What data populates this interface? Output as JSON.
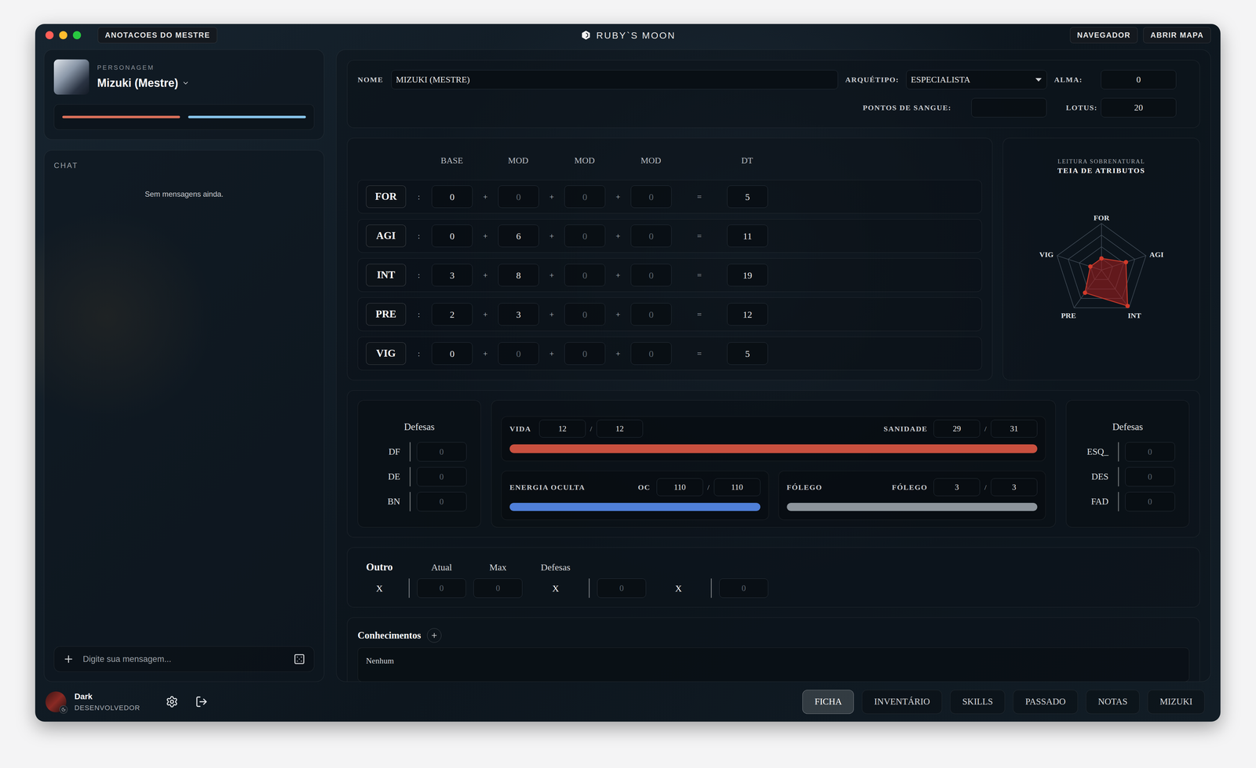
{
  "window": {
    "title": "RUBY`S MOON",
    "traffic_lights": [
      {
        "color": "#ff5f57"
      },
      {
        "color": "#febc2e"
      },
      {
        "color": "#28c840"
      }
    ],
    "left_button": "ANOTACOES DO MESTRE",
    "right_buttons": [
      "NAVEGADOR",
      "ABRIR MAPA"
    ]
  },
  "sidebar": {
    "character": {
      "label": "PERSONAGEM",
      "name": "Mizuki (Mestre)",
      "bars": [
        {
          "level": 1,
          "color": "#d9705a"
        },
        {
          "level": 1,
          "color": "#86c4ea"
        }
      ]
    },
    "chat": {
      "title": "CHAT",
      "empty_message": "Sem mensagens ainda.",
      "placeholder": "Digite sua mensagem..."
    },
    "user": {
      "name": "Dark",
      "role": "DESENVOLVEDOR"
    }
  },
  "identity": {
    "name": {
      "label": "NOME",
      "value": "MIZUKI (MESTRE)"
    },
    "archetype": {
      "label": "ARQUÉTIPO:",
      "value": "ESPECIALISTA"
    },
    "alma": {
      "label": "ALMA:",
      "value": "0"
    },
    "blood": {
      "label": "PONTOS DE SANGUE:",
      "value": ""
    },
    "lotus": {
      "label": "LOTUS:",
      "value": "20"
    }
  },
  "attributes": {
    "columns": [
      "BASE",
      "MOD",
      "MOD",
      "MOD",
      "DT"
    ],
    "colon": ":",
    "plus": "+",
    "equals": "=",
    "rows": [
      {
        "label": "FOR",
        "base": "0",
        "mods": [
          {
            "value": "0",
            "empty": true
          },
          {
            "value": "0",
            "empty": true
          },
          {
            "value": "0",
            "empty": true
          }
        ],
        "dt": "5"
      },
      {
        "label": "AGI",
        "base": "0",
        "mods": [
          {
            "value": "6",
            "empty": false
          },
          {
            "value": "0",
            "empty": true
          },
          {
            "value": "0",
            "empty": true
          }
        ],
        "dt": "11"
      },
      {
        "label": "INT",
        "base": "3",
        "mods": [
          {
            "value": "8",
            "empty": false
          },
          {
            "value": "0",
            "empty": true
          },
          {
            "value": "0",
            "empty": true
          }
        ],
        "dt": "19"
      },
      {
        "label": "PRE",
        "base": "2",
        "mods": [
          {
            "value": "3",
            "empty": false
          },
          {
            "value": "0",
            "empty": true
          },
          {
            "value": "0",
            "empty": true
          }
        ],
        "dt": "12"
      },
      {
        "label": "VIG",
        "base": "0",
        "mods": [
          {
            "value": "0",
            "empty": true
          },
          {
            "value": "0",
            "empty": true
          },
          {
            "value": "0",
            "empty": true
          }
        ],
        "dt": "5"
      }
    ]
  },
  "radar": {
    "subtitle": "LEITURA SOBRENATURAL",
    "title": "TEIA DE ATRIBUTOS",
    "axes": [
      "FOR",
      "AGI",
      "INT",
      "PRE",
      "VIG"
    ],
    "values": [
      5,
      11,
      19,
      12,
      5
    ]
  },
  "defenses_left": {
    "title": "Defesas",
    "rows": [
      {
        "label": "DF",
        "value": "0",
        "empty": true
      },
      {
        "label": "DE",
        "value": "0",
        "empty": true
      },
      {
        "label": "BN",
        "value": "0",
        "empty": true
      }
    ]
  },
  "defenses_right": {
    "title": "Defesas",
    "rows": [
      {
        "label": "ESQ_",
        "value": "0",
        "empty": true
      },
      {
        "label": "DES",
        "value": "0",
        "empty": true
      },
      {
        "label": "FAD",
        "value": "0",
        "empty": true
      }
    ]
  },
  "vitals": {
    "vida": {
      "label": "VIDA",
      "current": "12",
      "max": "12",
      "separator": "/",
      "level": 1,
      "color": "#c9503f"
    },
    "sanidade": {
      "label": "SANIDADE",
      "current": "29",
      "max": "31",
      "separator": "/"
    },
    "energy": {
      "label": "ENERGIA OCULTA",
      "short": "OC",
      "current": "110",
      "max": "110",
      "separator": "/",
      "level": 1,
      "color": "#4f7fd8"
    },
    "folego": {
      "label": "FÓLEGO",
      "short": "FÓLEGO",
      "current": "3",
      "max": "3",
      "separator": "/",
      "level": 1,
      "color": "#8d959c"
    }
  },
  "other": {
    "headers": [
      "Outro",
      "Atual",
      "Max",
      "Defesas"
    ],
    "label": "X",
    "current": {
      "value": "0",
      "empty": true
    },
    "max": {
      "value": "0",
      "empty": true
    },
    "defenses": [
      {
        "label": "X",
        "value": "0",
        "empty": true
      },
      {
        "label": "X",
        "value": "0",
        "empty": true
      }
    ]
  },
  "knowledge": {
    "title": "Conhecimentos",
    "empty_text": "Nenhum"
  },
  "tabs": [
    {
      "label": "FICHA",
      "selected": true
    },
    {
      "label": "INVENTÁRIO",
      "selected": false
    },
    {
      "label": "SKILLS",
      "selected": false
    },
    {
      "label": "PASSADO",
      "selected": false
    },
    {
      "label": "NOTAS",
      "selected": false
    },
    {
      "label": "MIZUKI",
      "selected": false
    }
  ]
}
